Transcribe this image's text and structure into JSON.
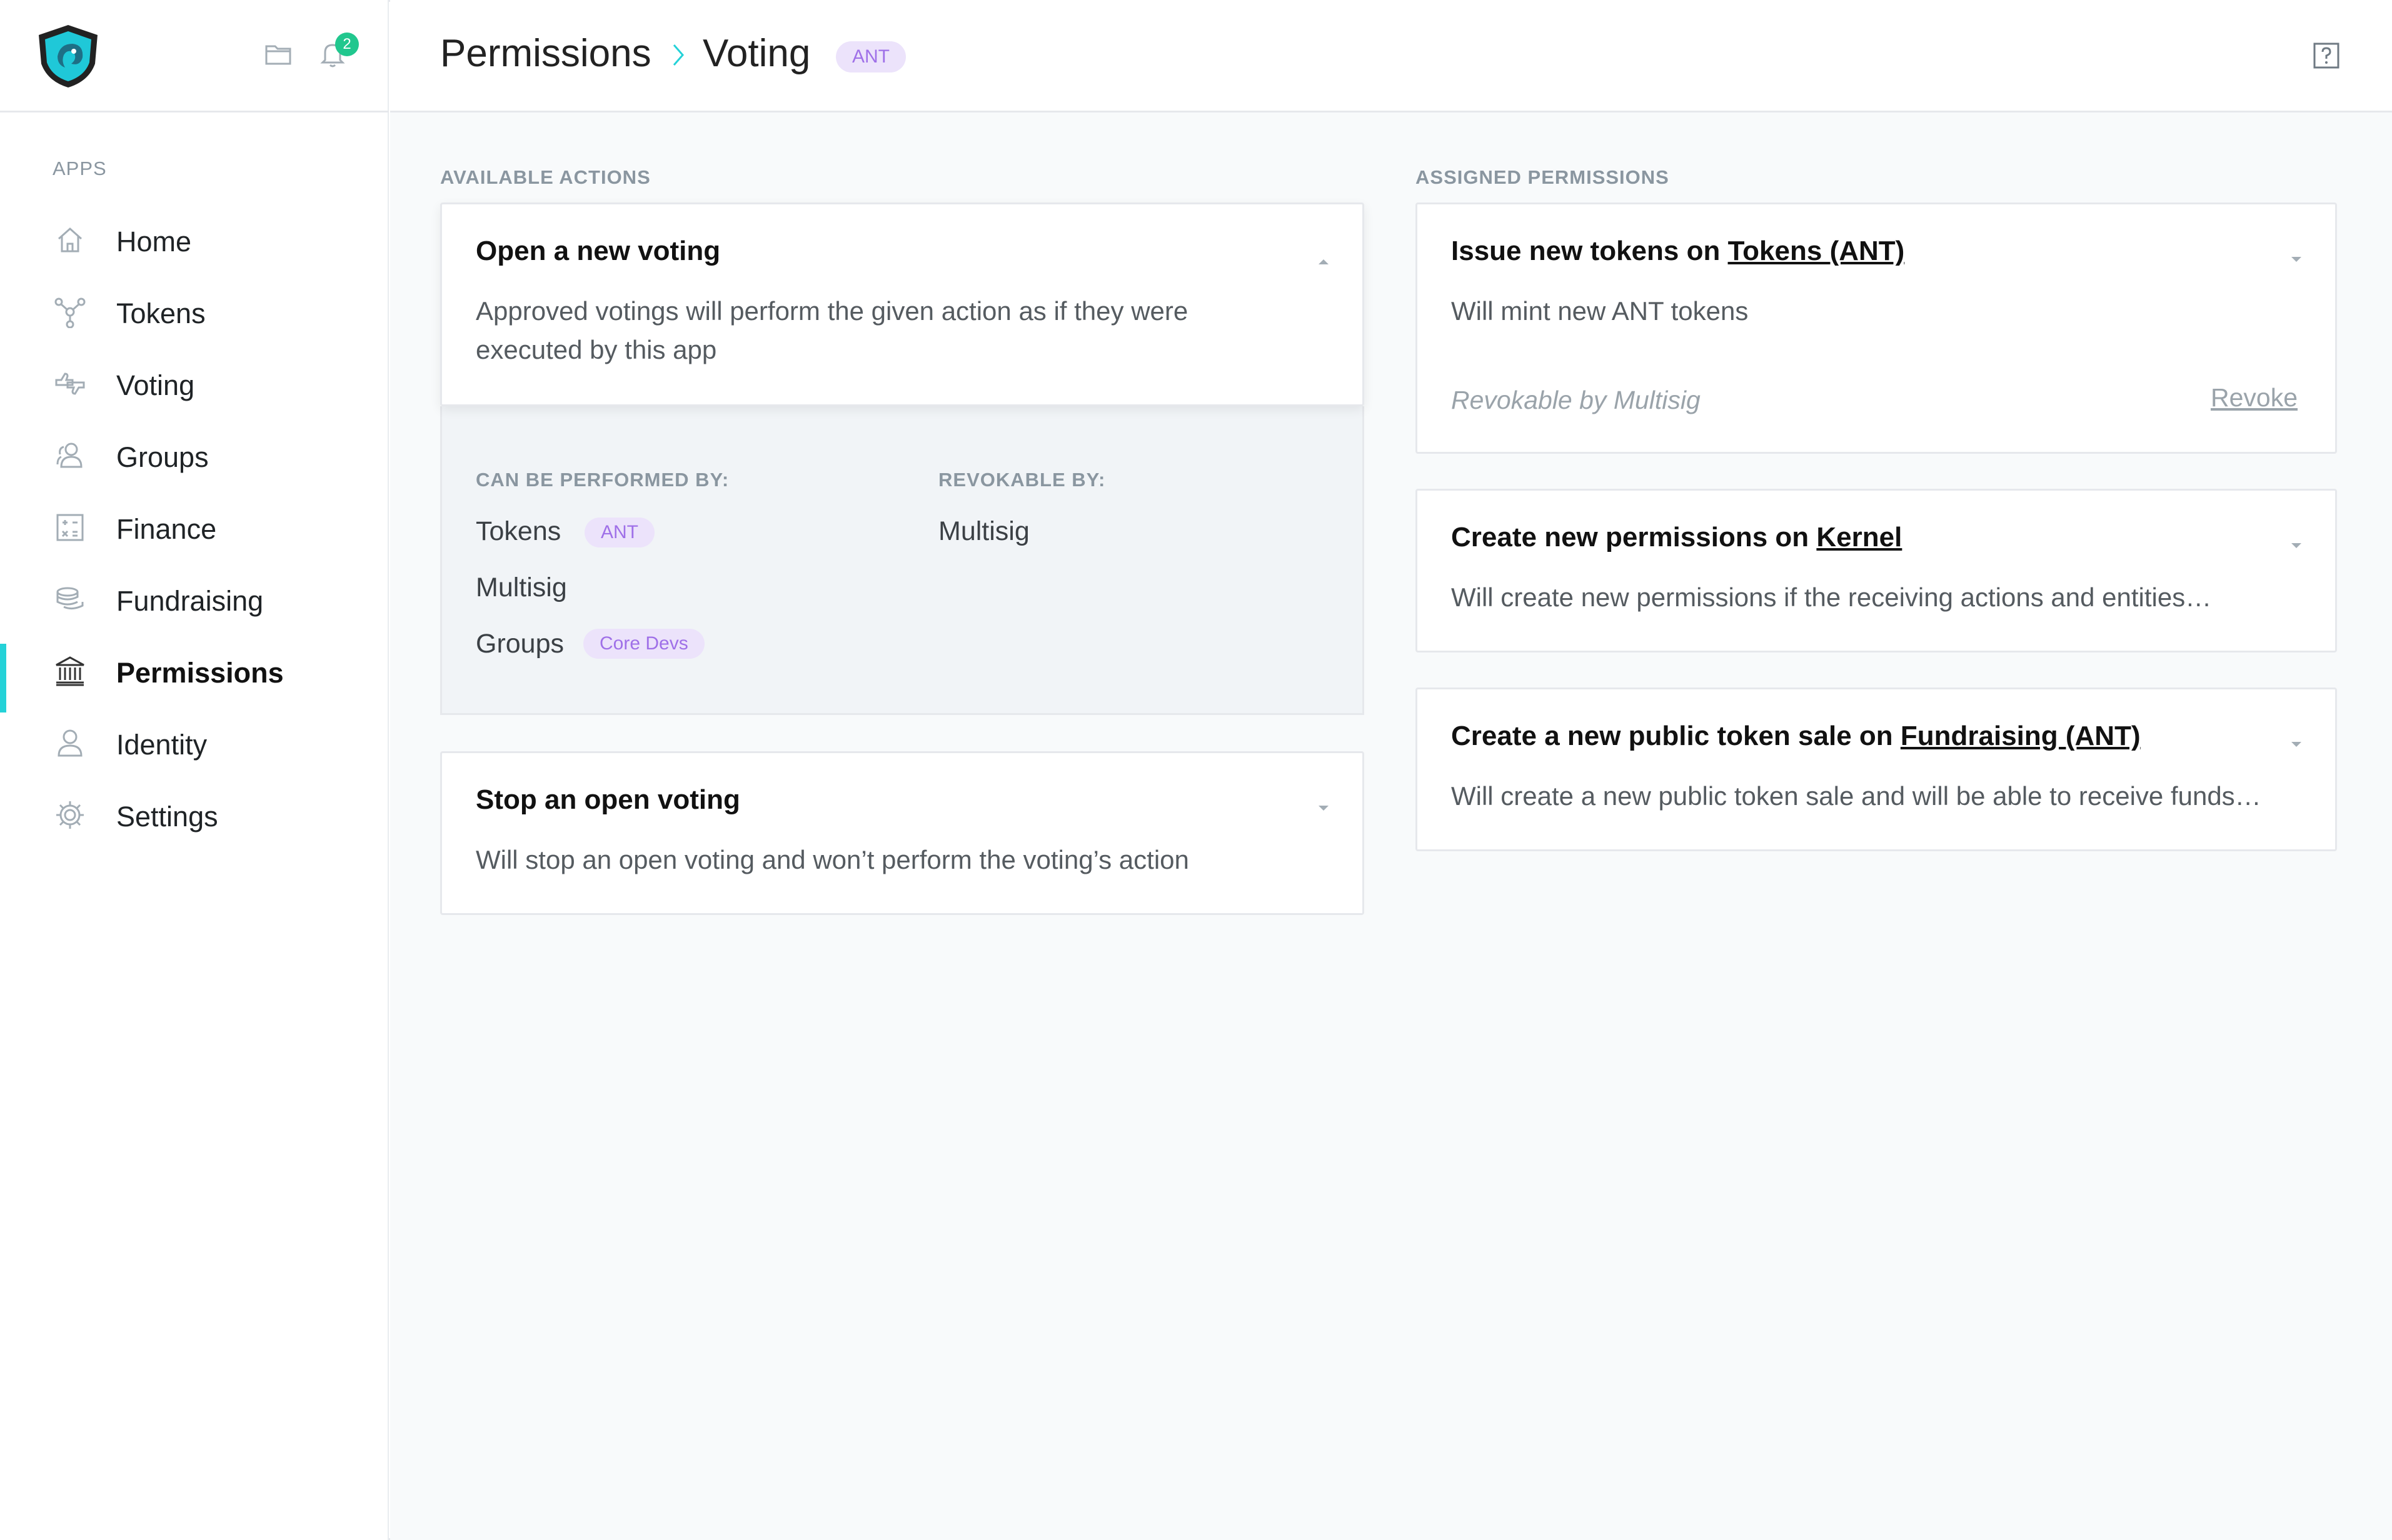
{
  "app": {
    "notification_count": "2",
    "accent_color": "#24d2d8",
    "badge_color": "#21c78e"
  },
  "sidebar": {
    "apps_label": "APPS",
    "items": [
      {
        "label": "Home",
        "icon": "home-icon"
      },
      {
        "label": "Tokens",
        "icon": "tokens-icon"
      },
      {
        "label": "Voting",
        "icon": "voting-icon"
      },
      {
        "label": "Groups",
        "icon": "groups-icon"
      },
      {
        "label": "Finance",
        "icon": "finance-icon"
      },
      {
        "label": "Fundraising",
        "icon": "fundraising-icon"
      },
      {
        "label": "Permissions",
        "icon": "permissions-icon",
        "active": true
      },
      {
        "label": "Identity",
        "icon": "identity-icon"
      },
      {
        "label": "Settings",
        "icon": "settings-icon"
      }
    ]
  },
  "header": {
    "breadcrumb_root": "Permissions",
    "breadcrumb_current": "Voting",
    "badge": "ANT"
  },
  "available_actions": {
    "label": "AVAILABLE ACTIONS",
    "open_voting": {
      "title": "Open a new voting",
      "desc_line1": "Approved votings will perform the given action as if they were",
      "desc_line2": "executed by this app",
      "performed_by_label": "CAN BE PERFORMED BY:",
      "revokable_by_label": "REVOKABLE BY:",
      "performers": [
        {
          "name": "Tokens",
          "tag": "ANT"
        },
        {
          "name": "Multisig",
          "tag": ""
        },
        {
          "name": "Groups",
          "tag": "Core Devs"
        }
      ],
      "revokers": [
        "Multisig"
      ]
    },
    "stop_voting": {
      "title": "Stop an open voting",
      "desc": "Will stop an open voting and won’t perform the voting’s action"
    }
  },
  "assigned_permissions": {
    "label": "ASSIGNED PERMISSIONS",
    "items": [
      {
        "title_prefix": "Issue new tokens on ",
        "title_link": "Tokens (ANT)",
        "desc": "Will mint new ANT tokens",
        "revokable": "Revokable by Multisig",
        "revoke_label": "Revoke"
      },
      {
        "title_prefix": "Create new permissions on ",
        "title_link": "Kernel",
        "desc": "Will create new permissions if the receiving actions and entities…"
      },
      {
        "title_prefix": "Create a new public token sale on ",
        "title_link": "Fundraising (ANT)",
        "desc": "Will create a new public token sale and will be able to receive funds…"
      }
    ]
  }
}
